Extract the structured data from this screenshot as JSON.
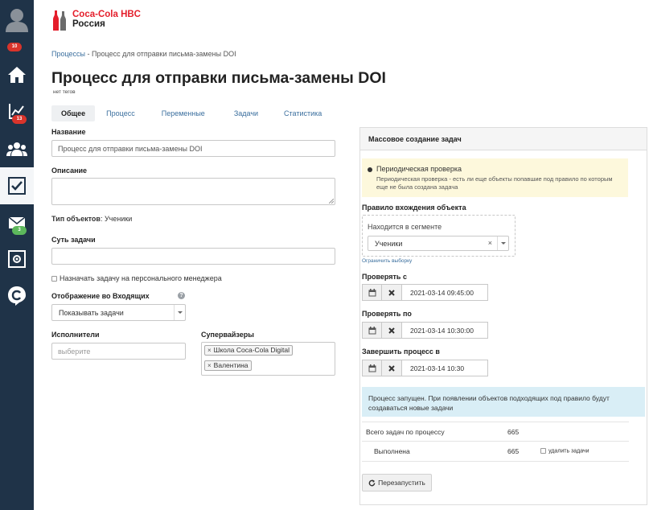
{
  "sidebar": {
    "badges": {
      "profile": "10",
      "analytics": "13",
      "mail": "3"
    }
  },
  "brand": {
    "name": "Coca-Cola HBC",
    "country": "Россия",
    "color": "#e41e2b"
  },
  "breadcrumb": {
    "parent": "Процессы",
    "separator": "-",
    "current": "Процесс для отправки письма-замены DOI"
  },
  "page": {
    "title": "Процесс для отправки письма-замены DOI",
    "tags": "нет тегов"
  },
  "tabs": [
    "Общее",
    "Процесс",
    "Переменные",
    "Задачи",
    "Статистика"
  ],
  "form": {
    "name_label": "Название",
    "name_value": "Процесс для отправки письма-замены DOI",
    "description_label": "Описание",
    "object_type_label": "Тип объектов",
    "object_type_value": ": Ученики",
    "task_label": "Суть задачи",
    "assign_manager_label": "Назначать задачу на персонального менеджера",
    "inbox_label": "Отображение во Входящих",
    "inbox_value": "Показывать задачи",
    "help": "?",
    "executors_label": "Исполнители",
    "executors_placeholder": "выберите",
    "supervisors_label": "Супервайзеры",
    "supervisors": [
      "Школа Coca-Cola Digital",
      "Валентина"
    ],
    "chip_remove": "×"
  },
  "panel": {
    "title": "Массовое создание задач",
    "periodic_label": "Периодическая проверка",
    "periodic_desc": "Периодическая проверка - есть ли еще объекты попавшие под правило по которым еще не была создана задача",
    "rule_label": "Правило вхождения объекта",
    "segment_label": "Находится в сегменте",
    "segment_value": "Ученики",
    "segment_clear": "×",
    "limit_link": "Ограничить выборку",
    "check_from_label": "Проверять с",
    "check_from_value": "2021-03-14 09:45:00",
    "check_to_label": "Проверять по",
    "check_to_value": "2021-03-14 10:30:00",
    "finish_label": "Завершить процесс в",
    "finish_value": "2021-03-14 10:30",
    "status_message": "Процесс запущен. При появлении объектов подходящих под правило будут создаваться новые задачи",
    "total_label": "Всего задач по процессу",
    "total_value": "665",
    "done_label": "Выполнена",
    "done_value": "665",
    "delete_tasks_label": "удалить задачи",
    "restart_label": "Перезапустить"
  }
}
